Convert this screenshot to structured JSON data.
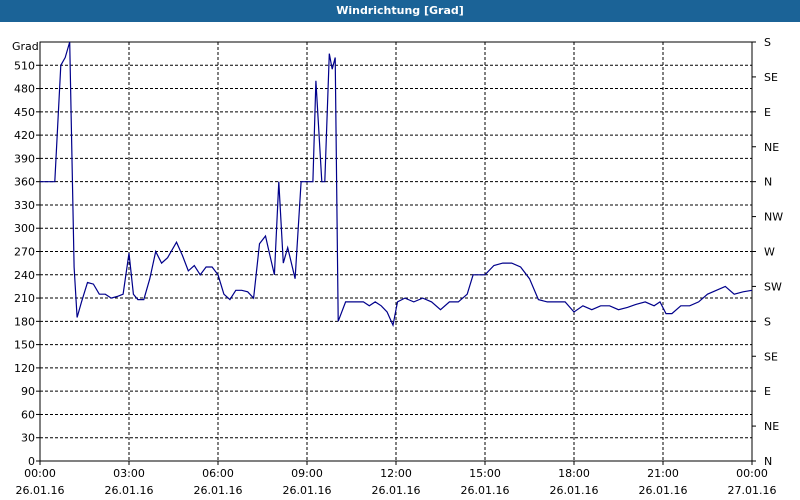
{
  "window": {
    "title": "Windrichtung [Grad]"
  },
  "chart_data": {
    "type": "line",
    "title": "Windrichtung [Grad]",
    "ylabel": "Grad",
    "xlabel": "",
    "ylim": [
      0,
      540
    ],
    "xlim_hours": [
      0,
      24
    ],
    "y_ticks": [
      "0",
      "30",
      "60",
      "90",
      "120",
      "150",
      "180",
      "210",
      "240",
      "270",
      "300",
      "330",
      "360",
      "390",
      "420",
      "450",
      "480",
      "510"
    ],
    "right_ticks": [
      "N",
      "NE",
      "E",
      "SE",
      "S",
      "SW",
      "W",
      "NW",
      "N",
      "NE",
      "E",
      "SE",
      "S"
    ],
    "x_ticks": [
      {
        "time": "00:00",
        "date": "26.01.16"
      },
      {
        "time": "03:00",
        "date": "26.01.16"
      },
      {
        "time": "06:00",
        "date": "26.01.16"
      },
      {
        "time": "09:00",
        "date": "26.01.16"
      },
      {
        "time": "12:00",
        "date": "26.01.16"
      },
      {
        "time": "15:00",
        "date": "26.01.16"
      },
      {
        "time": "18:00",
        "date": "26.01.16"
      },
      {
        "time": "21:00",
        "date": "26.01.16"
      },
      {
        "time": "00:00",
        "date": "27.01.16"
      }
    ],
    "grid": true,
    "colors": {
      "line": "#00008b",
      "grid": "#000000",
      "title_bar": "#1b6397"
    },
    "series": [
      {
        "x_hours": [
          0,
          0.5,
          0.7,
          0.85,
          1.0,
          1.15,
          1.25,
          1.4,
          1.6,
          1.8,
          2.0,
          2.2,
          2.4,
          2.6,
          2.8,
          3.0,
          3.15,
          3.3,
          3.5,
          3.7,
          3.9,
          4.1,
          4.3,
          4.6,
          4.8,
          5.0,
          5.2,
          5.4,
          5.6,
          5.8,
          6.0,
          6.2,
          6.4,
          6.6,
          6.8,
          7.0,
          7.2,
          7.4,
          7.6,
          7.75,
          7.9,
          8.05,
          8.2,
          8.35,
          8.6,
          8.8,
          9.0,
          9.1,
          9.2,
          9.3,
          9.5,
          9.6,
          9.75,
          9.85,
          9.95,
          10.05,
          10.3,
          10.6,
          10.9,
          11.1,
          11.3,
          11.5,
          11.7,
          11.9,
          12.05,
          12.3,
          12.6,
          12.9,
          13.2,
          13.5,
          13.8,
          14.1,
          14.4,
          14.6,
          14.8,
          15.0,
          15.3,
          15.6,
          15.9,
          16.2,
          16.5,
          16.8,
          17.1,
          17.4,
          17.7,
          18.0,
          18.3,
          18.6,
          18.9,
          19.2,
          19.5,
          19.8,
          20.1,
          20.4,
          20.7,
          20.9,
          21.1,
          21.3,
          21.6,
          21.9,
          22.2,
          22.5,
          22.8,
          23.1,
          23.4,
          23.7,
          24.0
        ],
        "y": [
          360,
          360,
          510,
          520,
          540,
          250,
          185,
          205,
          230,
          228,
          215,
          215,
          210,
          212,
          215,
          268,
          215,
          208,
          208,
          235,
          270,
          255,
          262,
          282,
          265,
          245,
          252,
          240,
          250,
          250,
          240,
          215,
          208,
          220,
          220,
          218,
          210,
          280,
          290,
          265,
          240,
          360,
          255,
          275,
          235,
          360,
          360,
          360,
          360,
          490,
          360,
          360,
          525,
          505,
          520,
          180,
          205,
          205,
          205,
          200,
          205,
          200,
          192,
          175,
          205,
          210,
          205,
          210,
          205,
          195,
          205,
          205,
          215,
          240,
          240,
          240,
          252,
          255,
          255,
          250,
          235,
          208,
          205,
          205,
          205,
          192,
          200,
          195,
          200,
          200,
          195,
          198,
          202,
          205,
          200,
          205,
          190,
          190,
          200,
          200,
          205,
          215,
          220,
          225,
          215,
          218,
          220
        ]
      }
    ]
  }
}
